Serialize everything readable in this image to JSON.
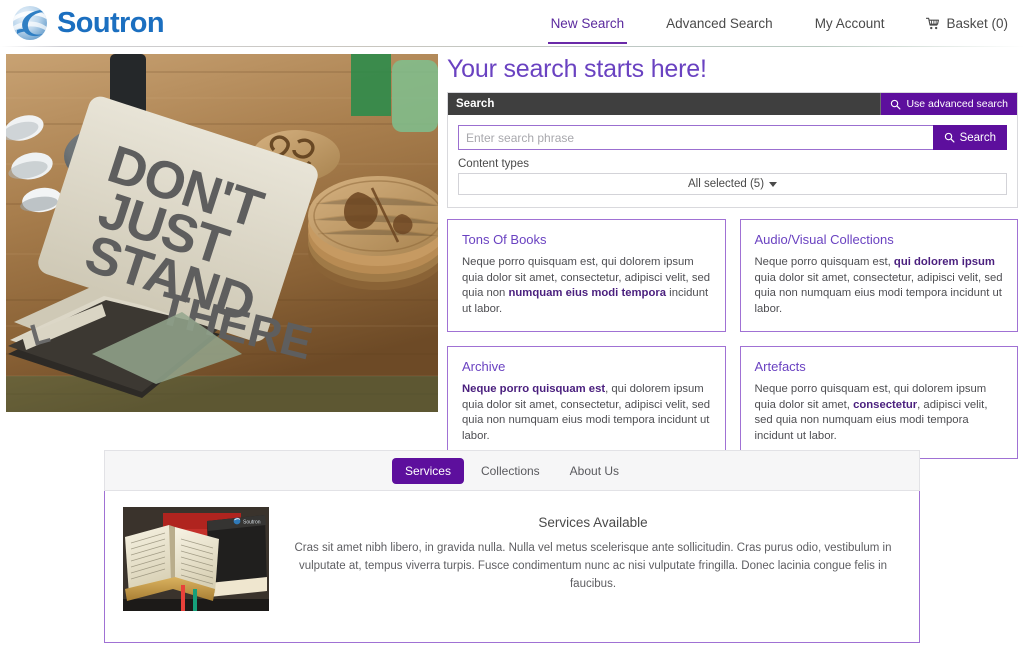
{
  "brand": {
    "name": "Soutron",
    "logo_icon": "soutron-sphere-logo"
  },
  "nav": {
    "items": [
      {
        "label": "New Search",
        "active": true
      },
      {
        "label": "Advanced Search",
        "active": false
      },
      {
        "label": "My Account",
        "active": false
      }
    ],
    "basket": {
      "label": "Basket (0)",
      "icon": "shopping-cart-icon"
    }
  },
  "hero": {
    "title": "Your search starts here!",
    "image_alt": "Letterpress cards reading DON'T JUST STAND THERE on a wooden workbench with bamboo coasters"
  },
  "search": {
    "panel_title": "Search",
    "advanced_button": "Use advanced search",
    "advanced_icon": "search-icon",
    "placeholder": "Enter search phrase",
    "value": "",
    "search_button": "Search",
    "search_icon": "search-icon",
    "content_types_label": "Content types",
    "content_types_value": "All selected (5)"
  },
  "cards": [
    {
      "title": "Tons Of Books",
      "pre": "Neque porro quisquam est, qui dolorem ipsum quia dolor sit amet, consectetur, adipisci velit, sed quia non ",
      "bold": "numquam eius modi tempora",
      "post": " incidunt ut labor."
    },
    {
      "title": "Audio/Visual Collections",
      "pre": "Neque porro quisquam est, ",
      "bold": "qui dolorem ipsum",
      "post": " quia dolor sit amet, consectetur, adipisci velit, sed quia non numquam eius modi tempora incidunt ut labor."
    },
    {
      "title": "Archive",
      "pre": "",
      "bold": "Neque porro quisquam est",
      "post": ", qui dolorem ipsum quia dolor sit amet, consectetur, adipisci velit, sed quia non numquam eius modi tempora incidunt ut labor."
    },
    {
      "title": "Artefacts",
      "pre": "Neque porro quisquam est, qui dolorem ipsum quia dolor sit amet, ",
      "bold": "consectetur",
      "post": ", adipisci velit, sed quia non numquam eius modi tempora incidunt ut labor."
    }
  ],
  "tabs": [
    {
      "label": "Services",
      "active": true
    },
    {
      "label": "Collections",
      "active": false
    },
    {
      "label": "About Us",
      "active": false
    }
  ],
  "panel": {
    "title": "Services Available",
    "text": "Cras sit amet nibh libero, in gravida nulla. Nulla vel metus scelerisque ante sollicitudin. Cras purus odio, vestibulum in vulputate at, tempus viverra turpis. Fusce condimentum nunc ac nisi vulputate fringilla. Donec lacinia congue felis in faucibus.",
    "thumbnail_alt": "Open book beside stacked red and black hardcover books",
    "thumbnail_watermark": "Soutron"
  },
  "colors": {
    "brand_blue": "#1b6fc0",
    "purple": "#5d0f9d",
    "purple_light": "#6a42c1",
    "card_border": "#a071d4",
    "dark_bar": "#3f3f3f"
  }
}
